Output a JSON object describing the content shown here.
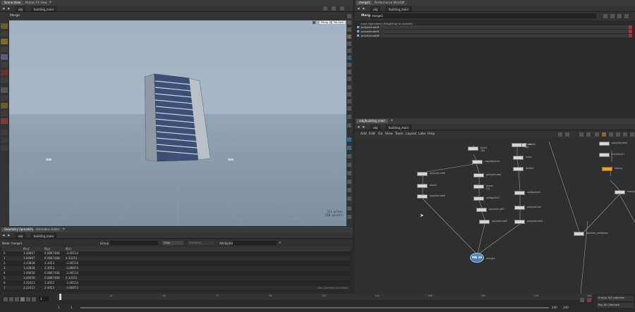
{
  "left_tabs": [
    "Scene View",
    "Motion FX View"
  ],
  "left_path": [
    "obj",
    "building_main"
  ],
  "viewport": {
    "title": "Merge",
    "camera_btn": "Persp",
    "view_btn": "No cam",
    "stats": [
      "311 prims",
      "510 points"
    ]
  },
  "spreadsheet": {
    "tabs": [
      "Geometry Spreadsheet",
      "Animation Editor"
    ],
    "path": [
      "obj",
      "building_main"
    ],
    "node_label": "Node: merge1",
    "group_label": "Group",
    "view_label": "View",
    "intrinsics_label": "Intrinsics",
    "attributes_label": "Attributes",
    "columns": [
      "",
      "P[x]",
      "P[y]",
      "P[z]"
    ],
    "rows": [
      [
        "0",
        "3.00867",
        "0.0867488",
        "-3.46514"
      ],
      [
        "1",
        "3.00867",
        "0.0867488",
        "0.33351"
      ],
      [
        "2",
        "3.43828",
        "2.4453",
        "-3.46514"
      ],
      [
        "3",
        "3.43828",
        "2.4453",
        "-3.86973"
      ],
      [
        "4",
        "3.00656",
        "0.0867488",
        "-3.46514"
      ],
      [
        "5",
        "3.00656",
        "0.0867488",
        "0.33351"
      ],
      [
        "6",
        "3.22413",
        "2.4453",
        "-3.46514"
      ],
      [
        "7",
        "3.22413",
        "2.4453",
        "-3.86973"
      ]
    ],
    "footer": "Non-Commercial Edition"
  },
  "right_tabs": [
    "merge1",
    "Performance Monitor"
  ],
  "right_path": [
    "obj",
    "building_main"
  ],
  "params": {
    "type_label": "Merge",
    "node_name": "merge1",
    "header": "Input Operators (Drag/Drop to reorder)",
    "inputs": [
      "polyextrude8",
      "polyextrude9",
      "polyextrude8"
    ]
  },
  "network": {
    "tab": "/obj/building_main",
    "path": [
      "obj",
      "building_main"
    ],
    "menu": [
      "Add",
      "Edit",
      "Go",
      "View",
      "Tools",
      "Layout",
      "Labs",
      "Help"
    ],
    "nodes": [
      {
        "label": "tube1",
        "sub": "100"
      },
      {
        "label": "blast3",
        "sub": ""
      },
      {
        "label": "copytopoints",
        "sub": ""
      },
      {
        "label": "polyextrude6",
        "sub": ""
      },
      {
        "label": "blast1",
        "sub": ""
      },
      {
        "label": "polyextrude8",
        "sub": ""
      },
      {
        "label": "polyextrude2",
        "sub": ""
      },
      {
        "label": "blast4",
        "sub": "2.0"
      },
      {
        "label": "splitpoints1",
        "sub": ""
      },
      {
        "label": "polyextrude2",
        "sub": ""
      },
      {
        "label": "polyextrude8",
        "sub": ""
      },
      {
        "label": "blast3",
        "sub": "100"
      },
      {
        "label": "fuse1",
        "sub": ""
      },
      {
        "label": "divide1",
        "sub": ""
      },
      {
        "label": "splitpoints2",
        "sub": ""
      },
      {
        "label": "polyextrude",
        "sub": ""
      },
      {
        "label": "polyextrude9",
        "sub": ""
      },
      {
        "label": "boolean_emitdown",
        "sub": ""
      },
      {
        "label": "polyextrude4",
        "sub": ""
      },
      {
        "label": "transform1",
        "sub": ""
      },
      {
        "label": "output",
        "sub": ""
      },
      {
        "label": "merge2",
        "sub": ""
      }
    ],
    "merge_badge": "MB 39",
    "merge_label": "merge1"
  },
  "timeline": {
    "ticks": [
      "24",
      "48",
      "72",
      "96",
      "120",
      "144",
      "168",
      "192",
      "216",
      "240"
    ],
    "frame": "1",
    "start": "1",
    "start2": "1",
    "end": "240",
    "end2": "240",
    "keys_label": "0 keys, 0/0 channels",
    "keyall_label": "Key All Channels"
  },
  "colors": {
    "accent": "#e3a63a",
    "merge_node": "#4a7fb0",
    "viewport_sky_top": "#a9b9c7",
    "viewport_ground": "#7f93a4"
  }
}
